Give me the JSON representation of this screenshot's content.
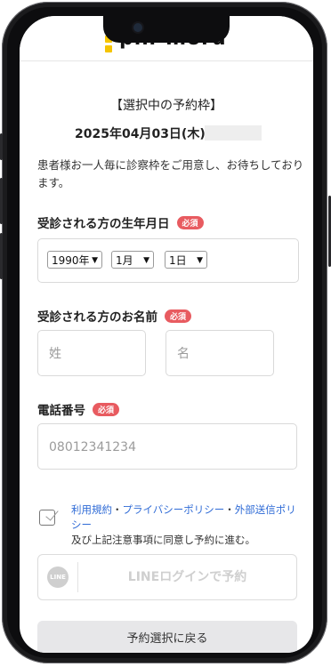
{
  "header": {
    "logo_text": "pin-moru"
  },
  "reservation": {
    "heading": "【選択中の予約枠】",
    "date": "2025年04月03日(木)"
  },
  "note": "患者様お一人毎に診察枠をご用意し、お待ちしております。",
  "dob": {
    "label": "受診される方の生年月日",
    "required": "必須",
    "year": "1990年",
    "month": "1月",
    "day": "1日"
  },
  "name": {
    "label": "受診される方のお名前",
    "required": "必須",
    "last_placeholder": "姓",
    "first_placeholder": "名"
  },
  "phone": {
    "label": "電話番号",
    "required": "必須",
    "placeholder": "08012341234"
  },
  "agreement": {
    "terms": "利用規約",
    "privacy": "プライバシーポリシー",
    "external": "外部送信ポリシー",
    "separator": "・",
    "suffix": "及び上記注意事項に同意し予約に進む。"
  },
  "line_button": {
    "icon_text": "LINE",
    "label": "LINEログインで予約"
  },
  "back_button": {
    "label": "予約選択に戻る"
  },
  "colors": {
    "accent_required": "#e85b60",
    "link": "#2f6bd6",
    "logo": "#f5c400"
  }
}
